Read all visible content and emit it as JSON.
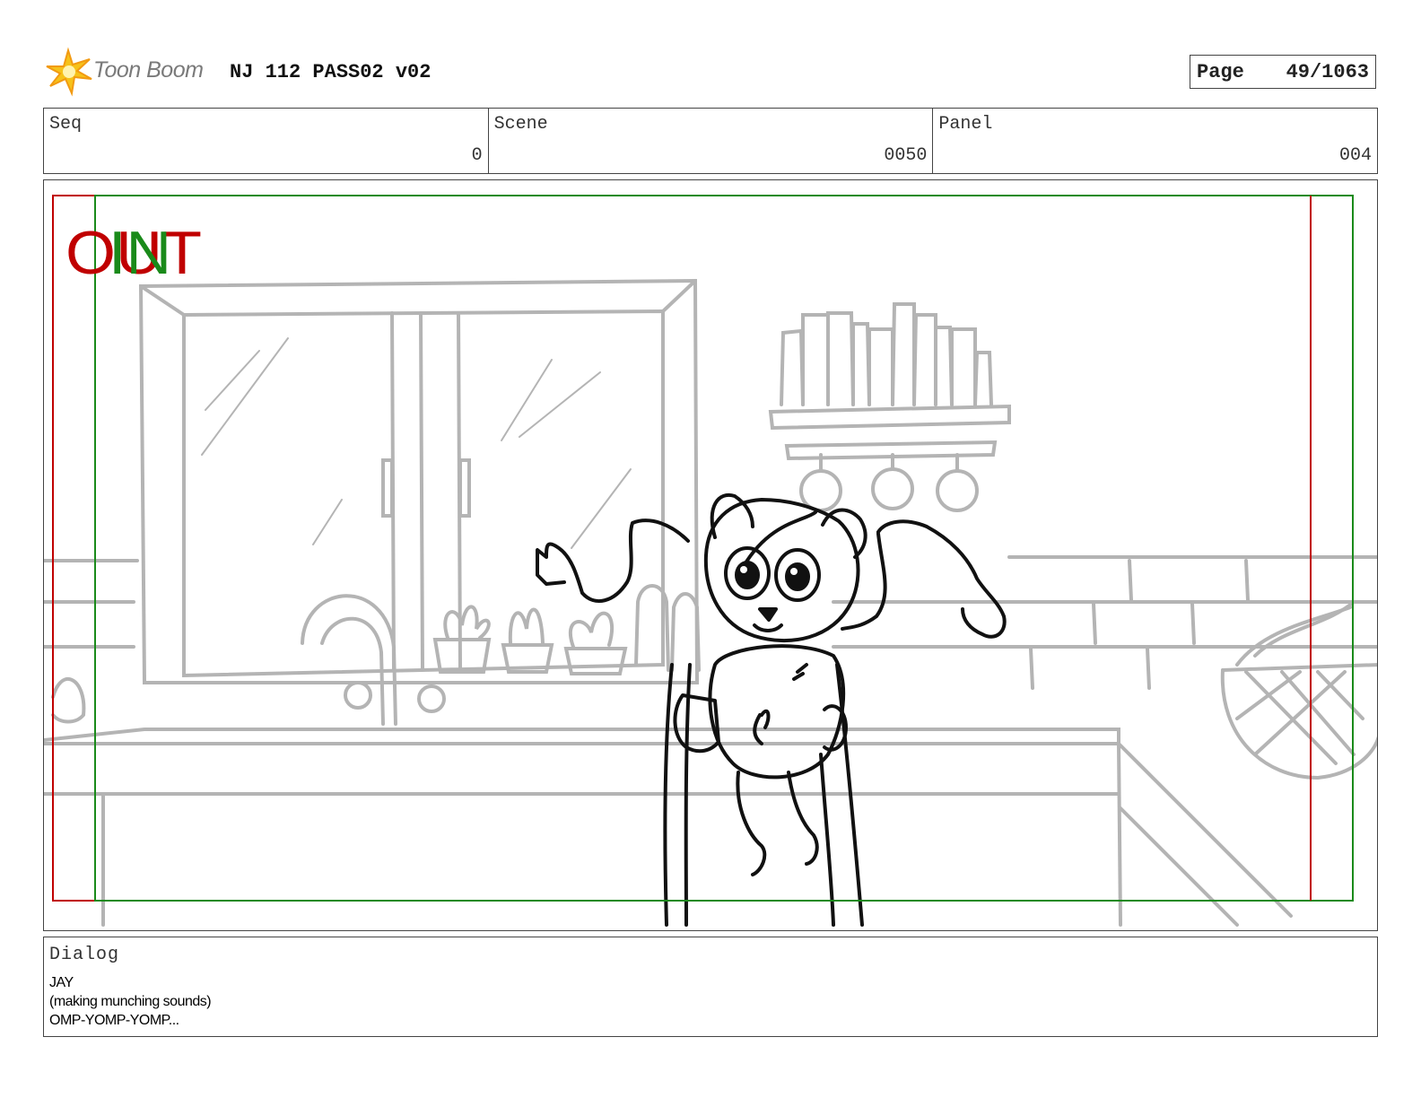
{
  "header": {
    "logo_text": "Toon Boom",
    "doc_title": "NJ 112 PASS02 v02",
    "page_label": "Page",
    "page_value": "49/1063"
  },
  "info": {
    "seq_label": "Seq",
    "seq_value": "0",
    "scene_label": "Scene",
    "scene_value": "0050",
    "panel_label": "Panel",
    "panel_value": "004"
  },
  "frame": {
    "out_text": "OUT",
    "in_text": "IN",
    "out_color": "#c00000",
    "in_color": "#1a8a1a"
  },
  "dialog": {
    "label": "Dialog",
    "lines": [
      "JAY",
      "(making munching sounds)",
      "OMP-YOMP-YOMP..."
    ]
  }
}
